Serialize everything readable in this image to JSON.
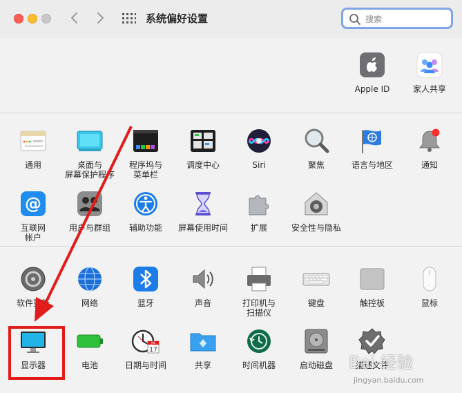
{
  "window": {
    "title": "系统偏好设置"
  },
  "search": {
    "placeholder": "搜索"
  },
  "account": [
    {
      "label": "Apple ID",
      "icon": "apple-id-icon"
    },
    {
      "label": "家人共享",
      "icon": "family-sharing-icon"
    }
  ],
  "row1": [
    {
      "label": "通用",
      "icon": "general-icon"
    },
    {
      "label": "桌面与\n屏幕保护程序",
      "icon": "desktop-screensaver-icon"
    },
    {
      "label": "程序坞与\n菜单栏",
      "icon": "dock-menubar-icon"
    },
    {
      "label": "调度中心",
      "icon": "mission-control-icon"
    },
    {
      "label": "Siri",
      "icon": "siri-icon"
    },
    {
      "label": "聚焦",
      "icon": "spotlight-icon"
    },
    {
      "label": "语言与地区",
      "icon": "language-region-icon"
    },
    {
      "label": "通知",
      "icon": "notifications-icon"
    }
  ],
  "row2": [
    {
      "label": "互联网\n帐户",
      "icon": "internet-accounts-icon"
    },
    {
      "label": "用户与群组",
      "icon": "users-groups-icon"
    },
    {
      "label": "辅助功能",
      "icon": "accessibility-icon"
    },
    {
      "label": "屏幕使用时间",
      "icon": "screen-time-icon"
    },
    {
      "label": "扩展",
      "icon": "extensions-icon"
    },
    {
      "label": "安全性与隐私",
      "icon": "security-privacy-icon"
    }
  ],
  "row3": [
    {
      "label": "软件更新",
      "icon": "software-update-icon"
    },
    {
      "label": "网络",
      "icon": "network-icon"
    },
    {
      "label": "蓝牙",
      "icon": "bluetooth-icon"
    },
    {
      "label": "声音",
      "icon": "sound-icon"
    },
    {
      "label": "打印机与\n扫描仪",
      "icon": "printers-scanners-icon"
    },
    {
      "label": "键盘",
      "icon": "keyboard-icon"
    },
    {
      "label": "触控板",
      "icon": "trackpad-icon"
    },
    {
      "label": "鼠标",
      "icon": "mouse-icon"
    }
  ],
  "row4": [
    {
      "label": "显示器",
      "icon": "displays-icon"
    },
    {
      "label": "电池",
      "icon": "battery-icon"
    },
    {
      "label": "日期与时间",
      "icon": "date-time-icon"
    },
    {
      "label": "共享",
      "icon": "sharing-icon"
    },
    {
      "label": "时间机器",
      "icon": "time-machine-icon"
    },
    {
      "label": "启动磁盘",
      "icon": "startup-disk-icon"
    },
    {
      "label": "描述文件",
      "icon": "profiles-icon"
    }
  ],
  "calendar": {
    "month": "JUL",
    "day": "17"
  },
  "watermark": {
    "brand": "Bai 经验",
    "url": "jingyan.baidu.com"
  },
  "colors": {
    "highlight": "#e21b1b",
    "search_focus": "#7ea5e6"
  }
}
